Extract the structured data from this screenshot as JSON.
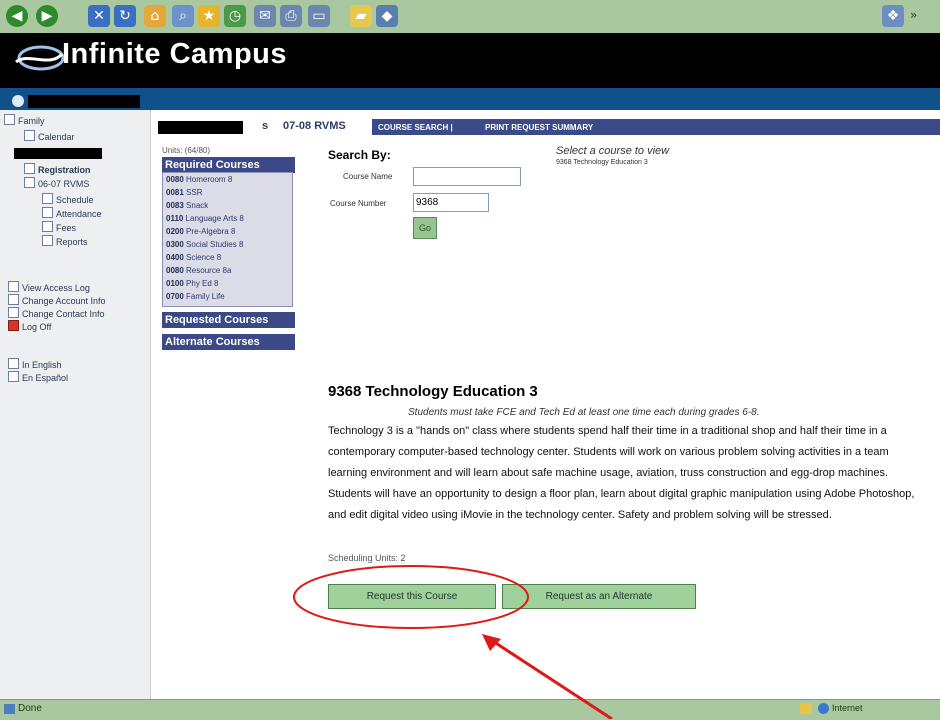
{
  "brand": {
    "name": "Infinite Campus"
  },
  "sidebar": {
    "items": [
      {
        "label": "Family",
        "icon": "family-icon"
      },
      {
        "label": "Calendar",
        "icon": "calendar-icon"
      },
      {
        "label": "Registration",
        "icon": "registration-icon"
      },
      {
        "label": "06-07 RVMS",
        "icon": "calendar-icon"
      },
      {
        "label": "Schedule",
        "icon": "schedule-icon"
      },
      {
        "label": "Attendance",
        "icon": "attendance-icon"
      },
      {
        "label": "Fees",
        "icon": "fees-icon"
      },
      {
        "label": "Reports",
        "icon": "reports-icon"
      },
      {
        "label": "View Access Log",
        "icon": "log-icon"
      },
      {
        "label": "Change Account Info",
        "icon": "edit-icon"
      },
      {
        "label": "Change Contact Info",
        "icon": "edit-icon"
      },
      {
        "label": "Log Off",
        "icon": "logoff-icon"
      },
      {
        "label": "In English",
        "icon": "language-icon"
      },
      {
        "label": "En Español",
        "icon": "language-icon"
      }
    ]
  },
  "header": {
    "suffix": "s",
    "school_year": "07-08 RVMS",
    "links": [
      "COURSE SEARCH |",
      "PRINT REQUEST SUMMARY"
    ]
  },
  "courses_panel": {
    "units": "Units: (64/80)",
    "required_title": "Required Courses",
    "required": [
      {
        "code": "0080",
        "name": "Homeroom 8"
      },
      {
        "code": "0081",
        "name": "SSR"
      },
      {
        "code": "0083",
        "name": "Snack"
      },
      {
        "code": "0110",
        "name": "Language Arts 8"
      },
      {
        "code": "0200",
        "name": "Pre-Algebra 8"
      },
      {
        "code": "0300",
        "name": "Social Studies 8"
      },
      {
        "code": "0400",
        "name": "Science 8"
      },
      {
        "code": "0080",
        "name": "Resource 8a"
      },
      {
        "code": "0100",
        "name": "Phy Ed 8"
      },
      {
        "code": "0700",
        "name": "Family Life"
      }
    ],
    "requested_title": "Requested Courses",
    "alternate_title": "Alternate Courses"
  },
  "search": {
    "title": "Search By:",
    "course_name_label": "Course Name",
    "course_name_value": "",
    "course_number_label": "Course Number",
    "course_number_value": "9368",
    "go_label": "Go",
    "select_hint": "Select a course to view",
    "selected_course": "9368 Technology Education 3"
  },
  "detail": {
    "title": "9368 Technology Education 3",
    "note": "Students must take FCE and Tech Ed at least one time each during grades 6-8.",
    "description": "Technology 3 is a \"hands on\" class where students spend half their time in a traditional shop and half their time in a contemporary computer-based technology center. Students will work on various problem solving activities in a team learning environment and will learn about safe machine usage, aviation, truss construction and egg-drop machines. Students will have an opportunity to design a floor plan, learn about digital graphic manipulation using Adobe Photoshop, and edit digital video using iMovie in the technology center. Safety and problem solving will be stressed.",
    "scheduling_units": "Scheduling Units: 2",
    "request_button": "Request this Course",
    "alternate_button": "Request as an Alternate"
  },
  "statusbar": {
    "status": "Done",
    "zone": "Internet"
  },
  "colors": {
    "annotation": "#e01818",
    "header_bar": "#3c4a8a",
    "button_green": "#9fd29a"
  }
}
